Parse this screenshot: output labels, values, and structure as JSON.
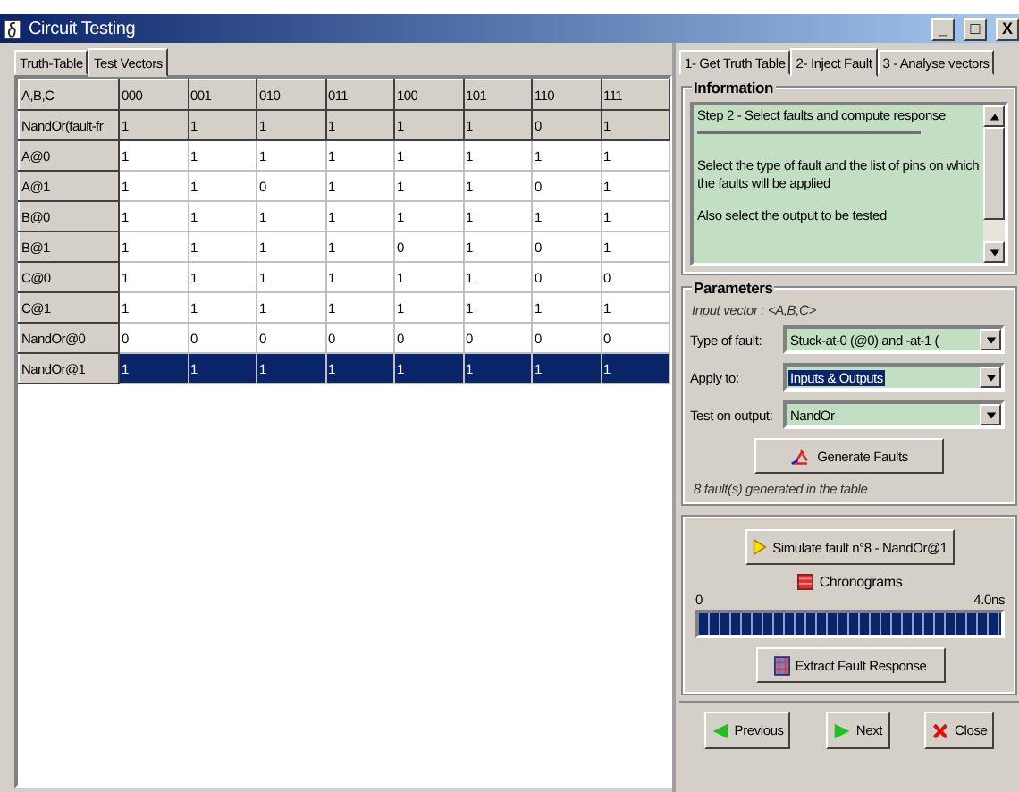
{
  "window": {
    "title": "Circuit Testing",
    "controls": [
      "_",
      "□",
      "X"
    ]
  },
  "left_tabs": [
    {
      "label": "Truth-Table",
      "selected": false
    },
    {
      "label": "Test Vectors",
      "selected": true
    }
  ],
  "table": {
    "columns": [
      "A,B,C",
      "000",
      "001",
      "010",
      "011",
      "100",
      "101",
      "110",
      "111"
    ],
    "rows": [
      {
        "kind": "reference",
        "selected": false,
        "cells": [
          "NandOr(fault-fr",
          "1",
          "1",
          "1",
          "1",
          "1",
          "1",
          "0",
          "1"
        ]
      },
      {
        "kind": "fault",
        "selected": false,
        "cells": [
          "A@0",
          "1",
          "1",
          "1",
          "1",
          "1",
          "1",
          "1",
          "1"
        ]
      },
      {
        "kind": "fault",
        "selected": false,
        "cells": [
          "A@1",
          "1",
          "1",
          "0",
          "1",
          "1",
          "1",
          "0",
          "1"
        ]
      },
      {
        "kind": "fault",
        "selected": false,
        "cells": [
          "B@0",
          "1",
          "1",
          "1",
          "1",
          "1",
          "1",
          "1",
          "1"
        ]
      },
      {
        "kind": "fault",
        "selected": false,
        "cells": [
          "B@1",
          "1",
          "1",
          "1",
          "1",
          "0",
          "1",
          "0",
          "1"
        ]
      },
      {
        "kind": "fault",
        "selected": false,
        "cells": [
          "C@0",
          "1",
          "1",
          "1",
          "1",
          "1",
          "1",
          "0",
          "0"
        ]
      },
      {
        "kind": "fault",
        "selected": false,
        "cells": [
          "C@1",
          "1",
          "1",
          "1",
          "1",
          "1",
          "1",
          "1",
          "1"
        ]
      },
      {
        "kind": "fault",
        "selected": false,
        "cells": [
          "NandOr@0",
          "0",
          "0",
          "0",
          "0",
          "0",
          "0",
          "0",
          "0"
        ]
      },
      {
        "kind": "fault",
        "selected": true,
        "cells": [
          "NandOr@1",
          "1",
          "1",
          "1",
          "1",
          "1",
          "1",
          "1",
          "1"
        ]
      }
    ]
  },
  "right_tabs": [
    {
      "label": "1- Get Truth Table",
      "selected": false
    },
    {
      "label": "2- Inject Fault",
      "selected": true
    },
    {
      "label": "3 - Analyse vectors",
      "selected": false
    }
  ],
  "information": {
    "title": "Information",
    "heading": "Step 2 - Select faults and compute response",
    "paragraphs": [
      "Select the type of fault and the list of pins on which the faults will be applied",
      "Also select the output to be tested"
    ]
  },
  "parameters": {
    "title": "Parameters",
    "input_vector": "Input vector : <A,B,C>",
    "fields": [
      {
        "label": "Type of fault:",
        "value": "Stuck-at-0 (@0) and -at-1 (",
        "highlighted": false
      },
      {
        "label": "Apply to:",
        "value": "Inputs & Outputs",
        "highlighted": true
      },
      {
        "label": "Test on output:",
        "value": "NandOr",
        "highlighted": false
      }
    ],
    "generate_button": "Generate Faults",
    "status": "8 fault(s) generated in the table"
  },
  "simulation": {
    "simulate_button": "Simulate fault n°8 - NandOr@1",
    "chronograms": "Chronograms",
    "scale_start": "0",
    "scale_end": "4.0ns",
    "level": 1,
    "extract_button": "Extract Fault Response"
  },
  "nav": [
    {
      "label": "Previous",
      "kind": "previous"
    },
    {
      "label": "Next",
      "kind": "next"
    },
    {
      "label": "Close",
      "kind": "close"
    }
  ]
}
